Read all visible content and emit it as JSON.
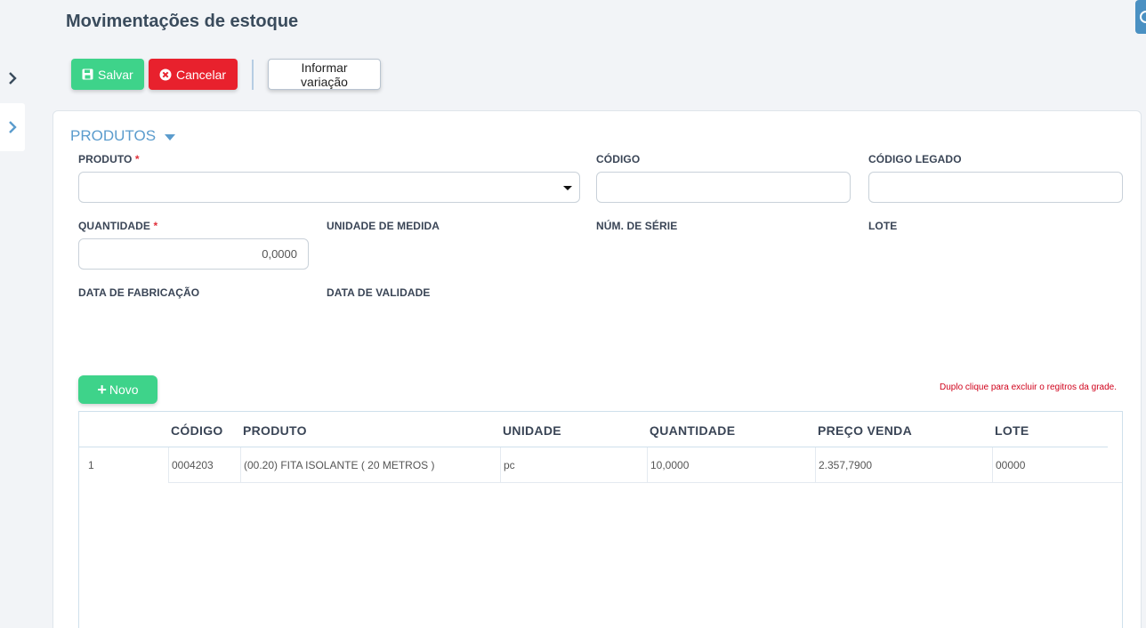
{
  "page": {
    "title": "Movimentações de estoque"
  },
  "toolbar": {
    "save_label": "Salvar",
    "cancel_label": "Cancelar",
    "variation_label": "Informar variação"
  },
  "section": {
    "title": "PRODUTOS"
  },
  "form": {
    "produto_label": "PRODUTO",
    "required_mark": "*",
    "codigo_label": "CÓDIGO",
    "codigo_legado_label": "CÓDIGO LEGADO",
    "quantidade_label": "QUANTIDADE",
    "quantidade_value": "0,0000",
    "unidade_label": "UNIDADE DE MEDIDA",
    "num_serie_label": "NÚM. DE SÉRIE",
    "lote_label": "LOTE",
    "data_fabricacao_label": "DATA DE FABRICAÇÃO",
    "data_validade_label": "DATA DE VALIDADE"
  },
  "grid": {
    "novo_label": "Novo",
    "hint": "Duplo clique para excluir o regitros da grade.",
    "columns": [
      "CÓDIGO",
      "PRODUTO",
      "UNIDADE",
      "QUANTIDADE",
      "PREÇO VENDA",
      "LOTE"
    ],
    "rows": [
      {
        "index": "1",
        "codigo": "0004203",
        "produto": "(00.20) FITA ISOLANTE ( 20 METROS )",
        "unidade": "pc",
        "quantidade": "10,0000",
        "preco": "2.357,7900",
        "lote": "00000"
      }
    ]
  },
  "colors": {
    "success": "#3ed38a",
    "danger": "#e8212d",
    "accent": "#5b9ccd",
    "required": "#e0303a",
    "hint": "#d0021b"
  },
  "icons": [
    "chevron-right-icon",
    "save-icon",
    "cancel-icon",
    "caret-down-icon",
    "plus-icon",
    "help-icon"
  ]
}
